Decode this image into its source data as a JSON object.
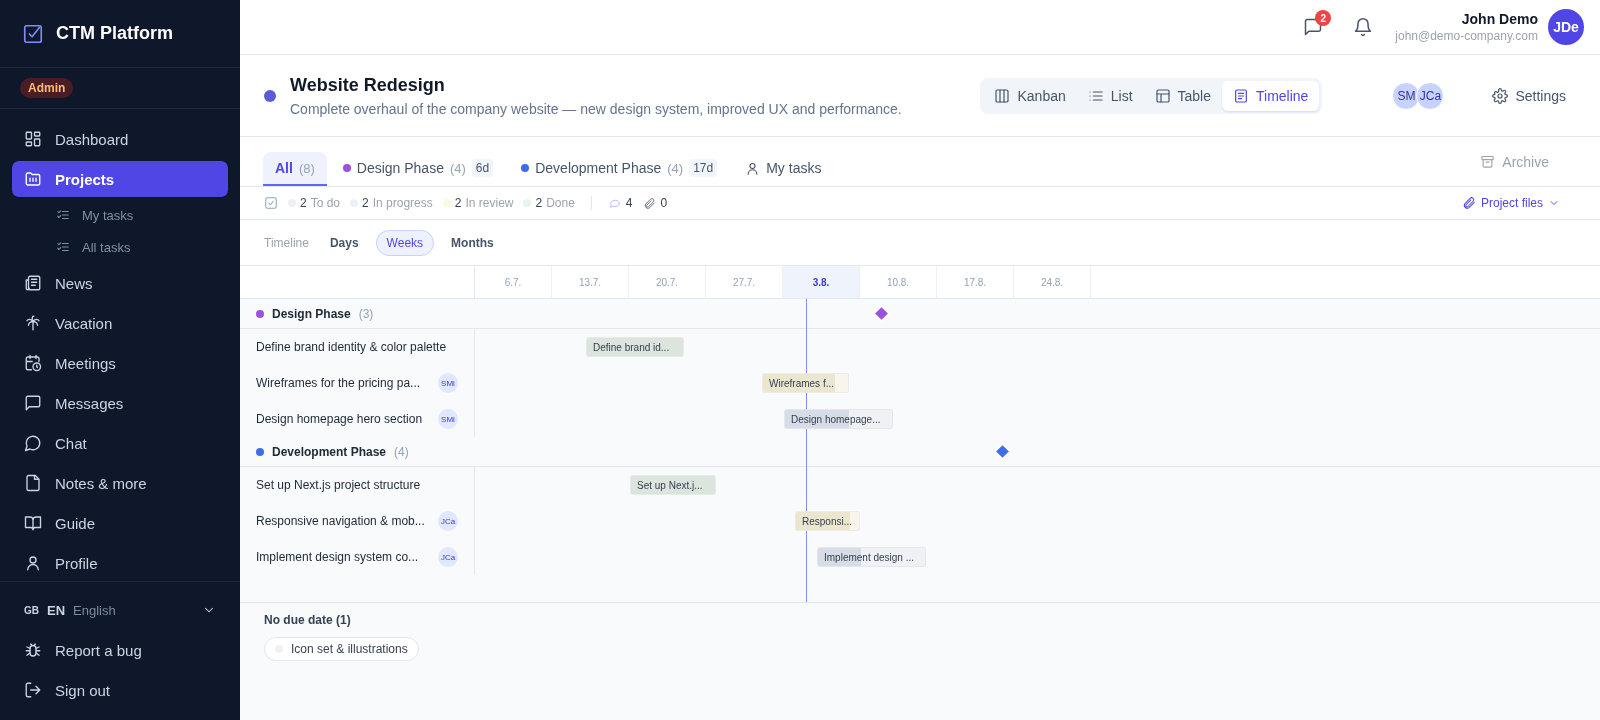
{
  "sidebar": {
    "logo": "CTM Platform",
    "role_badge": "Admin",
    "items": [
      {
        "label": "Dashboard",
        "selected": false
      },
      {
        "label": "Projects",
        "selected": true,
        "children": [
          {
            "label": "My tasks",
            "selected": false
          },
          {
            "label": "All tasks",
            "selected": false
          }
        ]
      },
      {
        "label": "News",
        "selected": false
      },
      {
        "label": "Vacation",
        "selected": false
      },
      {
        "label": "Meetings",
        "selected": false
      },
      {
        "label": "Messages",
        "selected": false
      },
      {
        "label": "Chat",
        "selected": false
      },
      {
        "label": "Notes & more",
        "selected": false
      },
      {
        "label": "Guide",
        "selected": false
      },
      {
        "label": "Profile",
        "selected": false
      }
    ],
    "language": {
      "flag": "GB",
      "code": "EN",
      "name": "English"
    },
    "footer_items": [
      {
        "label": "Report a bug"
      },
      {
        "label": "Sign out"
      }
    ]
  },
  "topbar": {
    "message_count": "2",
    "user_name": "John Demo",
    "user_email": "john@demo-company.com",
    "avatar": "JDe"
  },
  "project": {
    "color": "#5b5bd6",
    "title": "Website Redesign",
    "description": "Complete overhaul of the company website — new design system, improved UX and performance.",
    "views": [
      {
        "label": "Kanban",
        "selected": false
      },
      {
        "label": "List",
        "selected": false
      },
      {
        "label": "Table",
        "selected": false
      },
      {
        "label": "Timeline",
        "selected": true
      }
    ],
    "members": [
      "SM",
      "JCa"
    ],
    "settings": "Settings"
  },
  "tabs": [
    {
      "label": "All",
      "count": "(8)",
      "selected": true
    },
    {
      "label": "Design Phase",
      "count": "(4)",
      "duration": "6d",
      "color": "#9b51e0",
      "selected": false
    },
    {
      "label": "Development Phase",
      "count": "(4)",
      "duration": "17d",
      "color": "#3b6ee8",
      "selected": false
    },
    {
      "label": "My tasks",
      "selected": false
    }
  ],
  "archive": "Archive",
  "stats": [
    {
      "count": "2",
      "label": "To do",
      "color": "#eef0f3"
    },
    {
      "count": "2",
      "label": "In progress",
      "color": "#eaf1fd"
    },
    {
      "count": "2",
      "label": "In review",
      "color": "#fdf9dc"
    },
    {
      "count": "2",
      "label": "Done",
      "color": "#e6f4ec"
    }
  ],
  "comments": "4",
  "attachments": "0",
  "project_files": "Project files",
  "zoom": {
    "label": "Timeline",
    "options": [
      {
        "label": "Days",
        "selected": false
      },
      {
        "label": "Weeks",
        "selected": true
      },
      {
        "label": "Months",
        "selected": false
      }
    ]
  },
  "timeline": {
    "ticks": [
      {
        "label": "6.7.",
        "selected": false
      },
      {
        "label": "13.7.",
        "selected": false
      },
      {
        "label": "20.7.",
        "selected": false
      },
      {
        "label": "27.7.",
        "selected": false
      },
      {
        "label": "3.8.",
        "selected": true
      },
      {
        "label": "10.8.",
        "selected": false
      },
      {
        "label": "17.8.",
        "selected": false
      },
      {
        "label": "24.8.",
        "selected": false
      }
    ],
    "groups": [
      {
        "name": "Design Phase",
        "count": "(3)",
        "color": "#9b51e0",
        "tasks": [
          {
            "name": "Define brand identity & color palette",
            "bar_label": "Define brand id...",
            "color": "#dbe5dd",
            "level": 1
          },
          {
            "name": "Wireframes for the pricing pa...",
            "assignee": "SMi",
            "bar_label": "Wireframes f...",
            "color": "#ebe6cf",
            "level": 0.85
          },
          {
            "name": "Design homepage hero section",
            "assignee": "SMi",
            "bar_label": "Design homepage...",
            "color": "#d6dde6",
            "level": 0.6
          }
        ]
      },
      {
        "name": "Development Phase",
        "count": "(4)",
        "color": "#3b6ee8",
        "tasks": [
          {
            "name": "Set up Next.js project structure",
            "bar_label": "Set up Next.j...",
            "color": "#dbe5dd",
            "level": 1
          },
          {
            "name": "Responsive navigation & mob...",
            "assignee": "JCa",
            "bar_label": "Responsi...",
            "color": "#ebe6cf",
            "level": 0.85
          },
          {
            "name": "Implement design system co...",
            "assignee": "JCa",
            "bar_label": "Implement design ...",
            "color": "#d6dde6",
            "level": 0.4
          }
        ]
      }
    ]
  },
  "no_due_date": {
    "title": "No due date (1)",
    "tasks": [
      {
        "name": "Icon set & illustrations",
        "color": "#eef0f3"
      }
    ]
  }
}
